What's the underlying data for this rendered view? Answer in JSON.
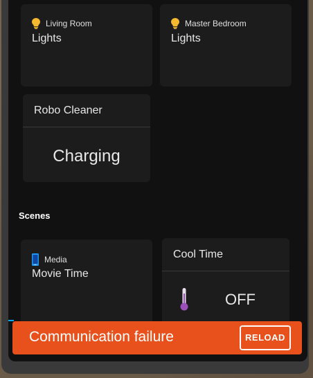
{
  "cards": {
    "living_room": {
      "area": "Living Room",
      "name": "Lights",
      "icon": "lightbulb-icon"
    },
    "master_bedroom": {
      "area": "Master Bedroom",
      "name": "Lights",
      "icon": "lightbulb-icon"
    },
    "robo_cleaner": {
      "title": "Robo Cleaner",
      "state": "Charging"
    }
  },
  "scenes": {
    "label": "Scenes",
    "media": {
      "area": "Media",
      "name": "Movie Time",
      "icon": "cellphone-icon"
    },
    "cool_time": {
      "title": "Cool Time",
      "state": "OFF",
      "icon": "thermometer-icon"
    }
  },
  "toast": {
    "message": "Communication failure",
    "action": "RELOAD",
    "color": "#e8501c"
  },
  "colors": {
    "bulb": "#f5b82e",
    "card": "#1c1c1c",
    "background": "#111111",
    "phone_icon": "#2196f3",
    "thermometer": "#9c4fb8"
  }
}
